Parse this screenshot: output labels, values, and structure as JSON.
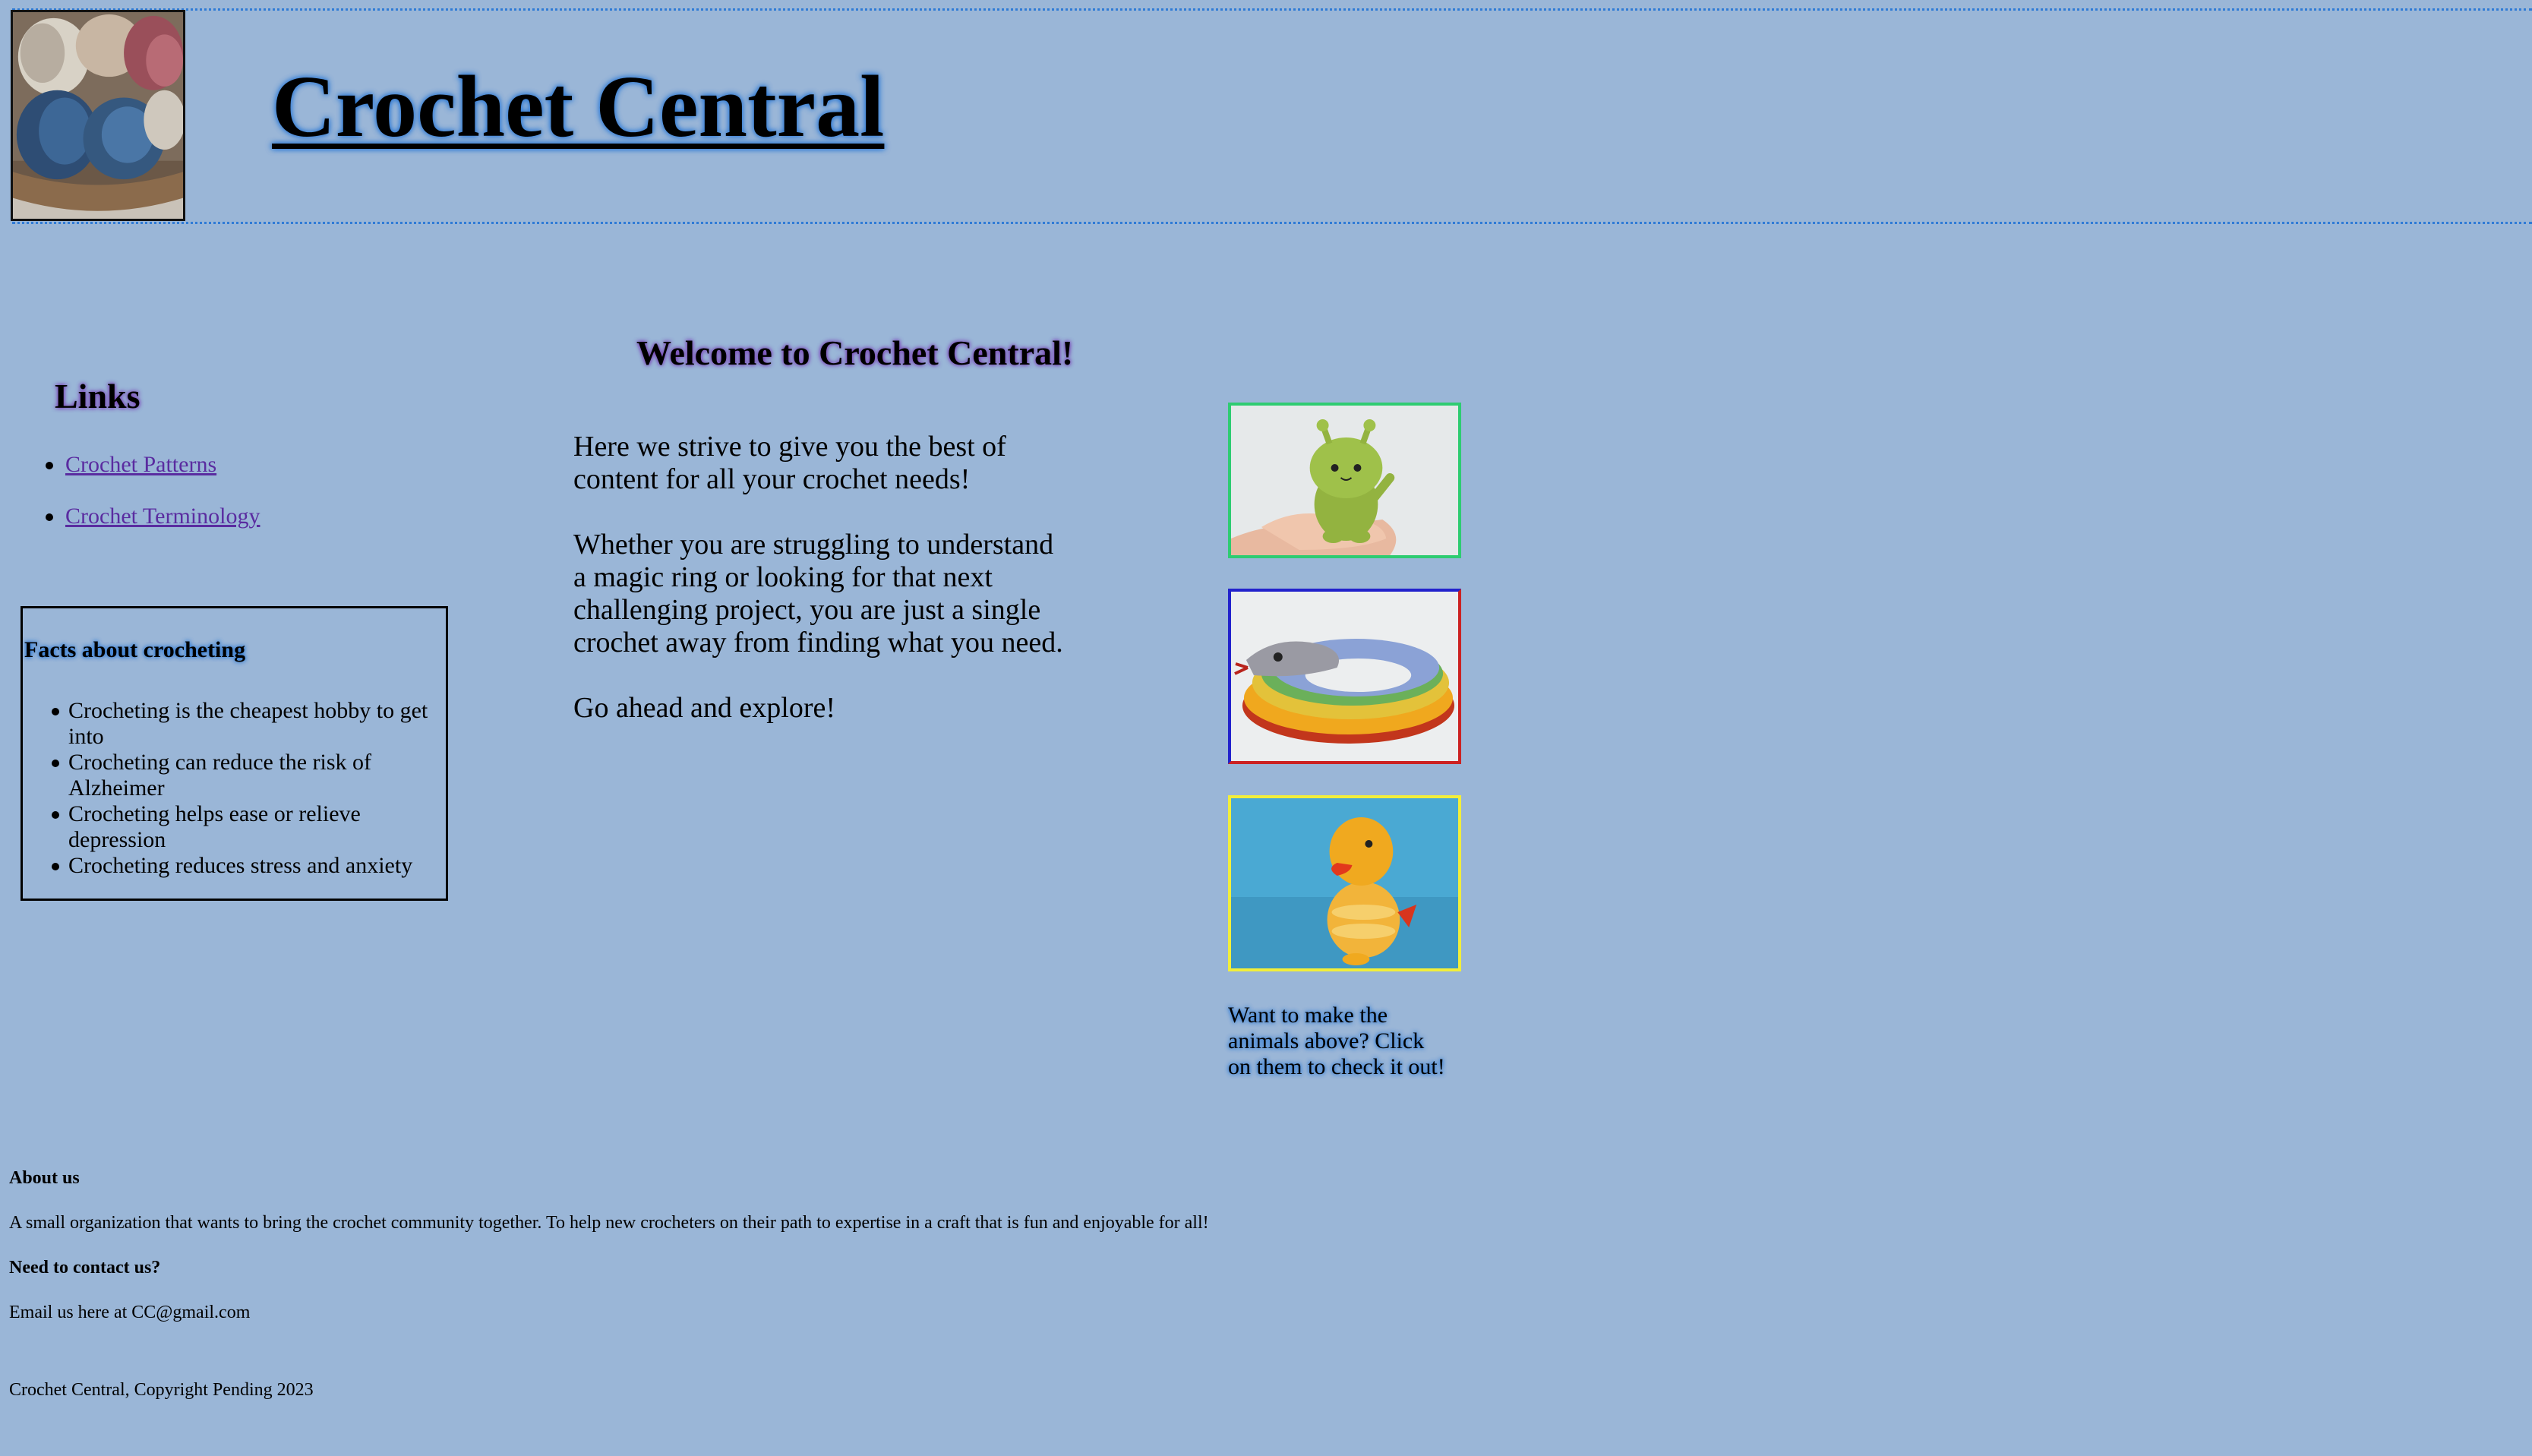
{
  "header": {
    "title": "Crochet Central",
    "logo_icon": "yarn-basket-photo"
  },
  "sidebar": {
    "links_heading": "Links",
    "links": [
      {
        "label": "Crochet Patterns"
      },
      {
        "label": "Crochet Terminology"
      }
    ],
    "facts_heading": "Facts about crocheting",
    "facts": [
      "Crocheting is the cheapest hobby to get into",
      "Crocheting can reduce the risk of Alzheimer",
      "Crocheting helps ease or relieve depression",
      "Crocheting reduces stress and anxiety"
    ]
  },
  "main": {
    "welcome_heading": "Welcome to Crochet Central!",
    "paragraphs": [
      "Here we strive to give you the best of content for all your crochet needs!",
      "Whether you are struggling to understand a magic ring or looking for that next challenging project, you are just a single crochet away from finding what you need.",
      "Go ahead and explore!"
    ]
  },
  "gallery": {
    "images": [
      {
        "icon": "alien-amigurumi-photo",
        "border_color": "#2ecc71"
      },
      {
        "icon": "snake-amigurumi-photo",
        "border_color": "#2222cc"
      },
      {
        "icon": "duck-amigurumi-photo",
        "border_color": "#f2ee3a"
      }
    ],
    "caption": "Want to make the animals above? Click on them to check it out!"
  },
  "footer": {
    "about_heading": "About us",
    "about_text": "A small organization that wants to bring the crochet community together. To help new crocheters on their path to expertise in a craft that is fun and enjoyable for all!",
    "contact_heading": "Need to contact us?",
    "contact_text": "Email us here at CC@gmail.com",
    "copyright": "Crochet Central, Copyright Pending 2023"
  },
  "colors": {
    "background": "#9ab6d7",
    "header_border": "#2f7bd6",
    "link": "#5a2ca0"
  }
}
